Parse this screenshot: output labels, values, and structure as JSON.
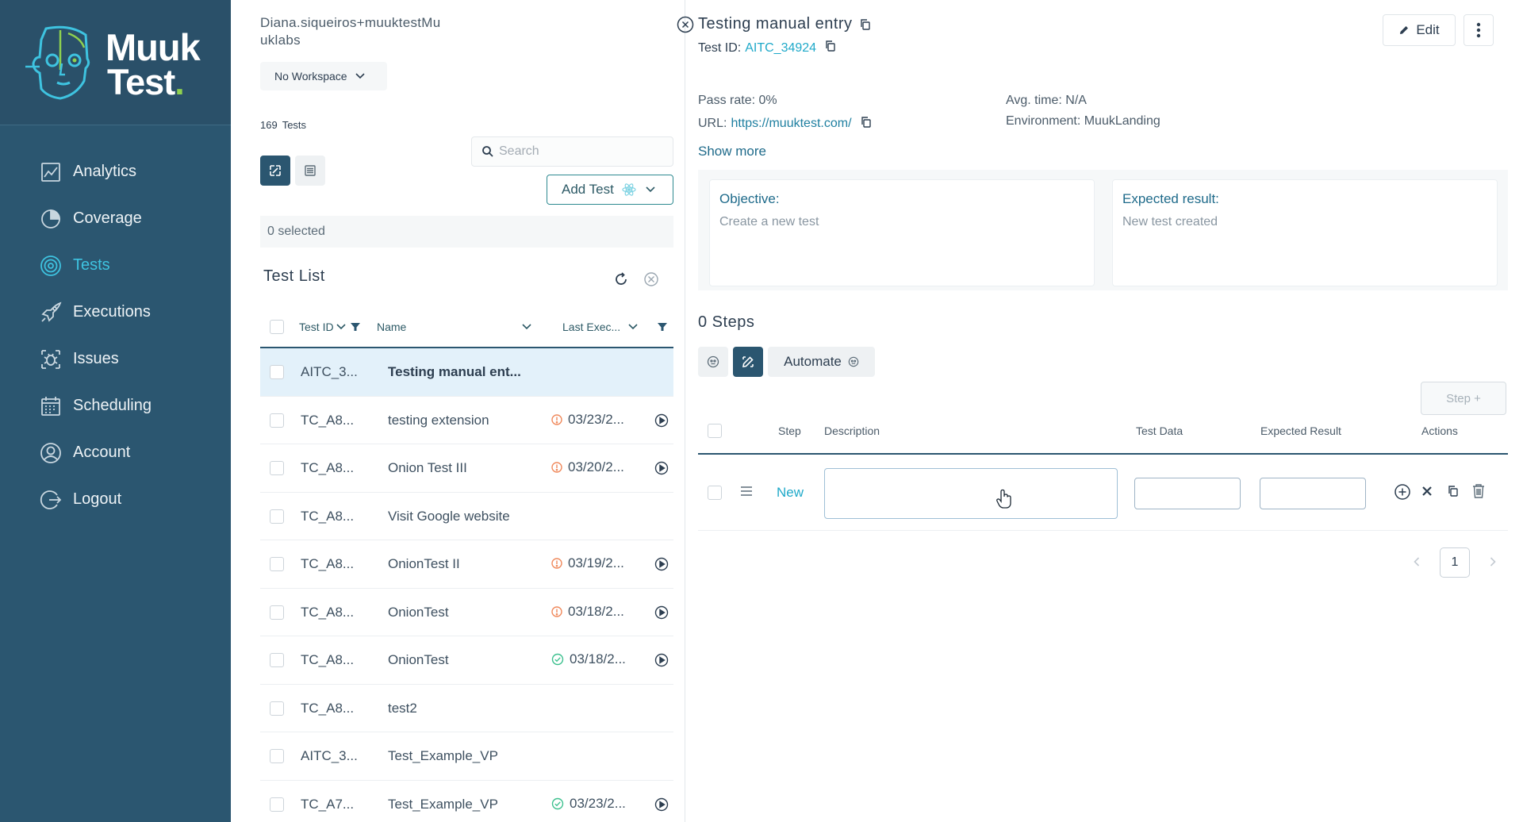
{
  "brand": {
    "line1": "Muuk",
    "line2": "Test",
    "mark": "."
  },
  "sidebar": {
    "items": [
      {
        "label": "Analytics",
        "icon": "analytics-icon"
      },
      {
        "label": "Coverage",
        "icon": "coverage-icon"
      },
      {
        "label": "Tests",
        "icon": "tests-icon",
        "active": true
      },
      {
        "label": "Executions",
        "icon": "rocket-icon"
      },
      {
        "label": "Issues",
        "icon": "bug-icon"
      },
      {
        "label": "Scheduling",
        "icon": "calendar-icon"
      },
      {
        "label": "Account",
        "icon": "user-icon"
      },
      {
        "label": "Logout",
        "icon": "logout-icon"
      }
    ]
  },
  "user": {
    "email_line1": "Diana.siqueiros+muuktestMu",
    "email_line2": "uklabs"
  },
  "workspace": {
    "label": "No Workspace"
  },
  "tests_count": {
    "number": "169",
    "label": "Tests"
  },
  "search": {
    "placeholder": "Search",
    "value": ""
  },
  "add_test": {
    "label": "Add Test"
  },
  "selection": {
    "text": "0 selected"
  },
  "test_list": {
    "title": "Test List",
    "headers": {
      "test_id": "Test ID",
      "name": "Name",
      "last_exec": "Last Exec..."
    },
    "rows": [
      {
        "id": "AITC_3...",
        "name": "Testing manual ent...",
        "date": "",
        "status": "",
        "selected": true
      },
      {
        "id": "TC_A8...",
        "name": "testing extension",
        "date": "03/23/2...",
        "status": "warning"
      },
      {
        "id": "TC_A8...",
        "name": "Onion Test III",
        "date": "03/20/2...",
        "status": "warning"
      },
      {
        "id": "TC_A8...",
        "name": "Visit Google website",
        "date": "",
        "status": ""
      },
      {
        "id": "TC_A8...",
        "name": "OnionTest II",
        "date": "03/19/2...",
        "status": "warning"
      },
      {
        "id": "TC_A8...",
        "name": "OnionTest",
        "date": "03/18/2...",
        "status": "warning"
      },
      {
        "id": "TC_A8...",
        "name": "OnionTest",
        "date": "03/18/2...",
        "status": "success"
      },
      {
        "id": "TC_A8...",
        "name": "test2",
        "date": "",
        "status": ""
      },
      {
        "id": "AITC_3...",
        "name": "Test_Example_VP",
        "date": "",
        "status": ""
      },
      {
        "id": "TC_A7...",
        "name": "Test_Example_VP",
        "date": "03/23/2...",
        "status": "success"
      }
    ]
  },
  "detail": {
    "title": "Testing manual entry",
    "test_id_label": "Test ID:",
    "test_id_value": "AITC_34924",
    "edit_label": "Edit",
    "pass_rate": "Pass rate: 0%",
    "url_label": "URL:",
    "url_value": "https://muuktest.com/",
    "avg_time": "Avg. time: N/A",
    "environment": "Environment: MuukLanding",
    "show_more": "Show more",
    "objective_label": "Objective:",
    "objective_value": "Create a new test",
    "expected_label": "Expected result:",
    "expected_value": "New test created",
    "steps_title": "0 Steps",
    "automate_label": "Automate",
    "step_plus_label": "Step +",
    "steps_headers": {
      "step": "Step",
      "description": "Description",
      "test_data": "Test Data",
      "expected_result": "Expected Result",
      "actions": "Actions"
    },
    "new_step_label": "New",
    "page_number": "1"
  },
  "colors": {
    "sidebar": "#2b5670",
    "accent": "#1fa9c9",
    "warning": "#f08a5d",
    "success": "#3cc08e"
  }
}
